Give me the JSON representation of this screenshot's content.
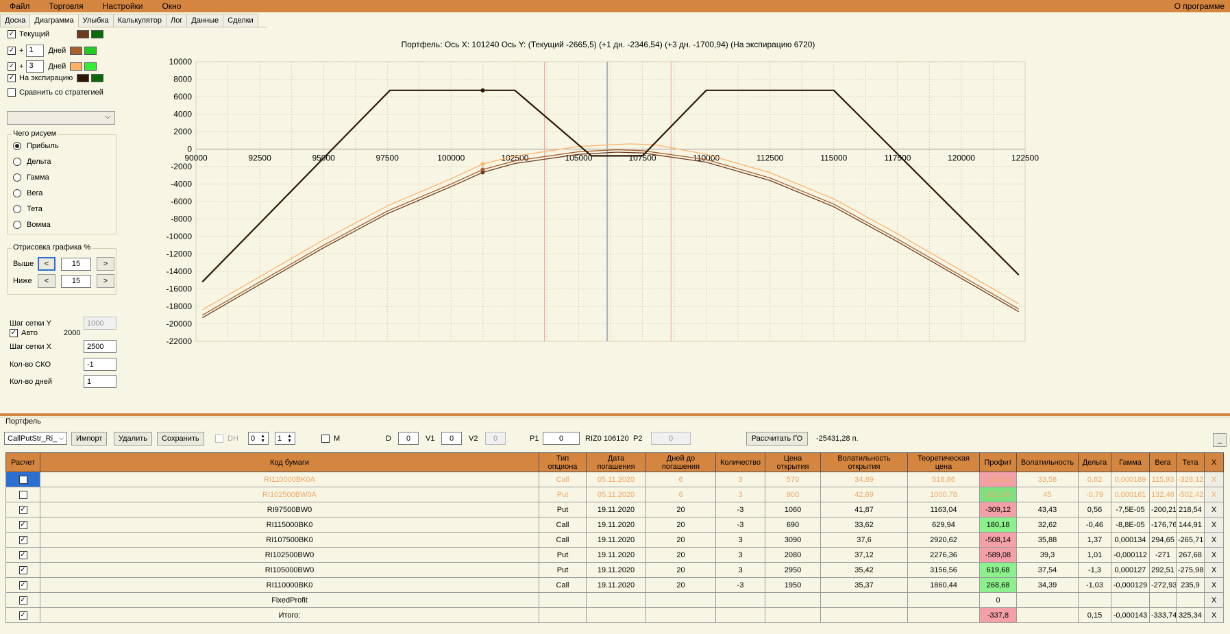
{
  "menu": {
    "items": [
      "Файл",
      "Торговля",
      "Настройки",
      "Окно"
    ],
    "about": "О программе"
  },
  "tabs": [
    "Доска",
    "Диаграмма",
    "Улыбка",
    "Калькулятор",
    "Лог",
    "Данные",
    "Сделки"
  ],
  "active_tab": "Диаграмма",
  "left": {
    "current_label": "Текущий",
    "plus": "+",
    "days_label": "Дней",
    "plus1_value": "1",
    "plus3_value": "3",
    "expiry_label": "На экспирацию",
    "compare_label": "Сравнить со стратегией",
    "what_legend": "Чего рисуем",
    "radios": [
      "Прибыль",
      "Дельта",
      "Гамма",
      "Вега",
      "Тета",
      "Вомма"
    ],
    "draw_legend": "Отрисовка графика %",
    "above_label": "Выше",
    "below_label": "Ниже",
    "above_value": "15",
    "below_value": "15",
    "lt": "<",
    "gt": ">",
    "grid_y_label": "Шаг сетки Y",
    "grid_y_value": "1000",
    "auto_label": "Авто",
    "auto_value": "2000",
    "grid_x_label": "Шаг сетки X",
    "grid_x_value": "2500",
    "sko_label": "Кол-во СКО",
    "sko_value": "-1",
    "days_count_label": "Кол-во дней",
    "days_count_value": "1",
    "colors": {
      "current": [
        "#6b3b1f",
        "#0a6a0a"
      ],
      "plus1": [
        "#a9602f",
        "#22cc22"
      ],
      "plus3": [
        "#ffb36a",
        "#33ee33"
      ],
      "expiry": [
        "#2b1608",
        "#0a6a0a"
      ]
    }
  },
  "chart_title": "Портфель: Ось X: 101240 Ось Y:  (Текущий -2665,5)  (+1 дн. -2346,54)  (+3 дн. -1700,94)  (На экспирацию 6720)",
  "chart_data": {
    "type": "line",
    "xlim": [
      90000,
      122500
    ],
    "ylim": [
      -22000,
      10000
    ],
    "x_ticks": [
      90000,
      92500,
      95000,
      97500,
      100000,
      102500,
      105000,
      107500,
      110000,
      112500,
      115000,
      117500,
      120000,
      122500
    ],
    "y_ticks": [
      10000,
      8000,
      6000,
      4000,
      2000,
      0,
      -2000,
      -4000,
      -6000,
      -8000,
      -10000,
      -12000,
      -14000,
      -16000,
      -18000,
      -20000,
      -22000
    ],
    "grid": true,
    "cursor_x": 101240,
    "center_x": 106120,
    "sd_lines": [
      103660,
      108620
    ],
    "series": [
      {
        "color": "#2b1608",
        "points": [
          [
            90250,
            -15200
          ],
          [
            97600,
            6720
          ],
          [
            102500,
            6720
          ],
          [
            105500,
            -780
          ],
          [
            107500,
            -780
          ],
          [
            110000,
            6720
          ],
          [
            115000,
            6720
          ],
          [
            122250,
            -14400
          ]
        ]
      },
      {
        "color": "#6b3b1f",
        "points": [
          [
            90250,
            -19300
          ],
          [
            92500,
            -15500
          ],
          [
            95000,
            -11300
          ],
          [
            97500,
            -7400
          ],
          [
            100000,
            -4300
          ],
          [
            101240,
            -2666
          ],
          [
            102500,
            -1650
          ],
          [
            105000,
            -600
          ],
          [
            106500,
            -350
          ],
          [
            107500,
            -450
          ],
          [
            110000,
            -1500
          ],
          [
            112500,
            -3600
          ],
          [
            115000,
            -6600
          ],
          [
            117500,
            -10600
          ],
          [
            120000,
            -14800
          ],
          [
            122250,
            -18600
          ]
        ]
      },
      {
        "color": "#a9602f",
        "points": [
          [
            90250,
            -19000
          ],
          [
            92500,
            -15200
          ],
          [
            95000,
            -11000
          ],
          [
            97500,
            -7100
          ],
          [
            100000,
            -4000
          ],
          [
            101240,
            -2347
          ],
          [
            102500,
            -1350
          ],
          [
            105000,
            -300
          ],
          [
            106500,
            -80
          ],
          [
            107500,
            -180
          ],
          [
            110000,
            -1200
          ],
          [
            112500,
            -3300
          ],
          [
            115000,
            -6300
          ],
          [
            117500,
            -10300
          ],
          [
            120000,
            -14500
          ],
          [
            122250,
            -18300
          ]
        ]
      },
      {
        "color": "#ffb36a",
        "points": [
          [
            90250,
            -18400
          ],
          [
            92500,
            -14600
          ],
          [
            95000,
            -10400
          ],
          [
            97500,
            -6500
          ],
          [
            100000,
            -3400
          ],
          [
            101240,
            -1701
          ],
          [
            102500,
            -800
          ],
          [
            105000,
            300
          ],
          [
            107000,
            600
          ],
          [
            108000,
            500
          ],
          [
            110000,
            -600
          ],
          [
            112500,
            -2700
          ],
          [
            115000,
            -5700
          ],
          [
            117500,
            -9700
          ],
          [
            120000,
            -13900
          ],
          [
            122250,
            -17700
          ]
        ]
      }
    ],
    "markers": [
      {
        "x": 101240,
        "y": 6720,
        "color": "#2b1608"
      },
      {
        "x": 101240,
        "y": -2666,
        "color": "#6b3b1f"
      },
      {
        "x": 101240,
        "y": -2347,
        "color": "#a9602f"
      },
      {
        "x": 101240,
        "y": -1701,
        "color": "#ffb36a"
      }
    ]
  },
  "portfolio": {
    "label": "Портфель",
    "strategy": "CallPutStr_Ri_",
    "import": "Импорт",
    "delete": "Удалить",
    "save": "Сохранить",
    "dh": "DH",
    "spin1": "0",
    "spin2": "1",
    "m_label": "M",
    "d_label": "D",
    "d_value": "0",
    "v1_label": "V1",
    "v1_value": "0",
    "v2_label": "V2",
    "v2_value": "0",
    "p1_label": "P1",
    "p1_value": "0",
    "riz": "RIZ0 106120",
    "p2_label": "P2",
    "p2_value": "0",
    "calc_go": "Рассчитать ГО",
    "go_value": "-25431,28 п.",
    "minimize": "_"
  },
  "table": {
    "headers": [
      "Расчет",
      "Код бумаги",
      "Тип опциона",
      "Дата погашения",
      "Дней до погашения",
      "Количество",
      "Цена открытия",
      "Волатильность открытия",
      "Теоретическая цена",
      "Профит",
      "Волатильность",
      "Дельта",
      "Гамма",
      "Вега",
      "Тета",
      "X"
    ],
    "rows": [
      {
        "checked": false,
        "dim": true,
        "sel": true,
        "cells": [
          "RI110000BK0A",
          "Call",
          "05.11.2020",
          "6",
          "3",
          "570",
          "34,89",
          "518,86",
          "-153,42",
          "33,58",
          "0,62",
          "0,000189",
          "115,93",
          "-328,12"
        ],
        "pclass": "neg"
      },
      {
        "checked": false,
        "dim": true,
        "cells": [
          "RI102500BW0A",
          "Put",
          "05.11.2020",
          "6",
          "3",
          "900",
          "42,69",
          "1000,78",
          "302,34",
          "45",
          "-0,79",
          "0,000161",
          "132,46",
          "-502,42"
        ],
        "pclass": "pos"
      },
      {
        "checked": true,
        "cells": [
          "RI97500BW0",
          "Put",
          "19.11.2020",
          "20",
          "-3",
          "1060",
          "41,87",
          "1163,04",
          "-309,12",
          "43,43",
          "0,56",
          "-7,5E-05",
          "-200,21",
          "218,54"
        ],
        "pclass": "neg"
      },
      {
        "checked": true,
        "cells": [
          "RI115000BK0",
          "Call",
          "19.11.2020",
          "20",
          "-3",
          "690",
          "33,62",
          "629,94",
          "180,18",
          "32,62",
          "-0,46",
          "-8,8E-05",
          "-176,76",
          "144,91"
        ],
        "pclass": "pos"
      },
      {
        "checked": true,
        "cells": [
          "RI107500BK0",
          "Call",
          "19.11.2020",
          "20",
          "3",
          "3090",
          "37,6",
          "2920,62",
          "-508,14",
          "35,88",
          "1,37",
          "0,000134",
          "294,65",
          "-265,71"
        ],
        "pclass": "neg"
      },
      {
        "checked": true,
        "cells": [
          "RI102500BW0",
          "Put",
          "19.11.2020",
          "20",
          "3",
          "2080",
          "37,12",
          "2276,36",
          "-589,08",
          "39,3",
          "1,01",
          "-0,000112",
          "-271",
          "267,68"
        ],
        "pclass": "neg"
      },
      {
        "checked": true,
        "cells": [
          "RI105000BW0",
          "Put",
          "19.11.2020",
          "20",
          "3",
          "2950",
          "35,42",
          "3156,56",
          "619,68",
          "37,54",
          "-1,3",
          "0,000127",
          "292,51",
          "-275,98"
        ],
        "pclass": "pos"
      },
      {
        "checked": true,
        "cells": [
          "RI110000BK0",
          "Call",
          "19.11.2020",
          "20",
          "-3",
          "1950",
          "35,37",
          "1860,44",
          "268,68",
          "34,39",
          "-1,03",
          "-0,000129",
          "-272,93",
          "235,9"
        ],
        "pclass": "pos"
      },
      {
        "checked": true,
        "cells": [
          "FixedProfit",
          "",
          "",
          "",
          "",
          "",
          "",
          "",
          "0",
          "",
          "",
          "",
          "",
          ""
        ],
        "pclass": ""
      },
      {
        "checked": true,
        "cells": [
          "Итого:",
          "",
          "",
          "",
          "",
          "",
          "",
          "",
          "-337,8",
          "",
          "0,15",
          "-0,000143",
          "-333,74",
          "325,34"
        ],
        "pclass": "neg"
      }
    ],
    "x_label": "X"
  }
}
